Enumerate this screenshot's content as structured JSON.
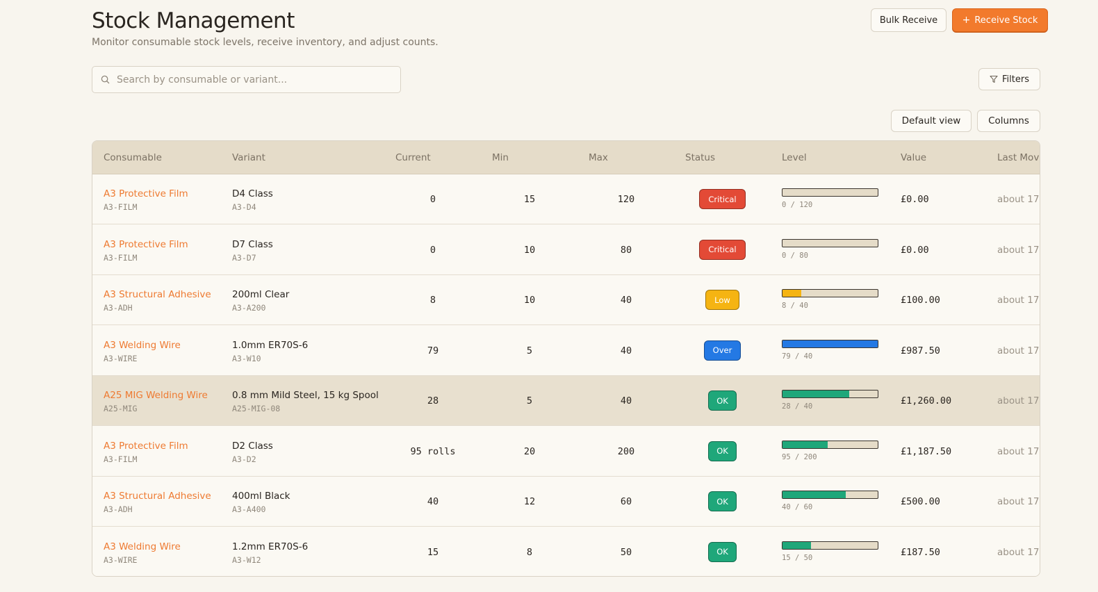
{
  "header": {
    "title": "Stock Management",
    "subtitle": "Monitor consumable stock levels, receive inventory, and adjust counts.",
    "bulk_receive_label": "Bulk Receive",
    "receive_stock_label": "Receive Stock"
  },
  "search": {
    "placeholder": "Search by consumable or variant...",
    "value": ""
  },
  "toolbar": {
    "filters_label": "Filters",
    "default_view_label": "Default view",
    "columns_label": "Columns"
  },
  "colors": {
    "accent": "#f27a2c",
    "critical": "#e34a36",
    "low": "#f5b412",
    "over": "#2479e4",
    "ok": "#1fa77a"
  },
  "table": {
    "columns": [
      "Consumable",
      "Variant",
      "Current",
      "Min",
      "Max",
      "Status",
      "Level",
      "Value",
      "Last Move"
    ],
    "rows": [
      {
        "consumable": "A3 Protective Film",
        "consumable_code": "A3-FILM",
        "variant": "D4 Class",
        "variant_code": "A3-D4",
        "current": "0",
        "min": "15",
        "max": "120",
        "status": "Critical",
        "level_text": "0 / 120",
        "level_fraction": 0,
        "value": "£0.00",
        "last": "about 17"
      },
      {
        "consumable": "A3 Protective Film",
        "consumable_code": "A3-FILM",
        "variant": "D7 Class",
        "variant_code": "A3-D7",
        "current": "0",
        "min": "10",
        "max": "80",
        "status": "Critical",
        "level_text": "0 / 80",
        "level_fraction": 0,
        "value": "£0.00",
        "last": "about 17"
      },
      {
        "consumable": "A3 Structural Adhesive",
        "consumable_code": "A3-ADH",
        "variant": "200ml Clear",
        "variant_code": "A3-A200",
        "current": "8",
        "min": "10",
        "max": "40",
        "status": "Low",
        "level_text": "8 / 40",
        "level_fraction": 0.2,
        "value": "£100.00",
        "last": "about 17"
      },
      {
        "consumable": "A3 Welding Wire",
        "consumable_code": "A3-WIRE",
        "variant": "1.0mm ER70S-6",
        "variant_code": "A3-W10",
        "current": "79",
        "min": "5",
        "max": "40",
        "status": "Over",
        "level_text": "79 / 40",
        "level_fraction": 1,
        "value": "£987.50",
        "last": "about 17"
      },
      {
        "consumable": "A25 MIG Welding Wire",
        "consumable_code": "A25-MIG",
        "variant": "0.8 mm Mild Steel, 15 kg Spool",
        "variant_code": "A25-MIG-08",
        "current": "28",
        "min": "5",
        "max": "40",
        "status": "OK",
        "level_text": "28 / 40",
        "level_fraction": 0.7,
        "value": "£1,260.00",
        "last": "about 17",
        "highlighted": true
      },
      {
        "consumable": "A3 Protective Film",
        "consumable_code": "A3-FILM",
        "variant": "D2 Class",
        "variant_code": "A3-D2",
        "current": "95 rolls",
        "min": "20",
        "max": "200",
        "status": "OK",
        "level_text": "95 / 200",
        "level_fraction": 0.475,
        "value": "£1,187.50",
        "last": "about 17"
      },
      {
        "consumable": "A3 Structural Adhesive",
        "consumable_code": "A3-ADH",
        "variant": "400ml Black",
        "variant_code": "A3-A400",
        "current": "40",
        "min": "12",
        "max": "60",
        "status": "OK",
        "level_text": "40 / 60",
        "level_fraction": 0.667,
        "value": "£500.00",
        "last": "about 17"
      },
      {
        "consumable": "A3 Welding Wire",
        "consumable_code": "A3-WIRE",
        "variant": "1.2mm ER70S-6",
        "variant_code": "A3-W12",
        "current": "15",
        "min": "8",
        "max": "50",
        "status": "OK",
        "level_text": "15 / 50",
        "level_fraction": 0.3,
        "value": "£187.50",
        "last": "about 17"
      }
    ]
  }
}
